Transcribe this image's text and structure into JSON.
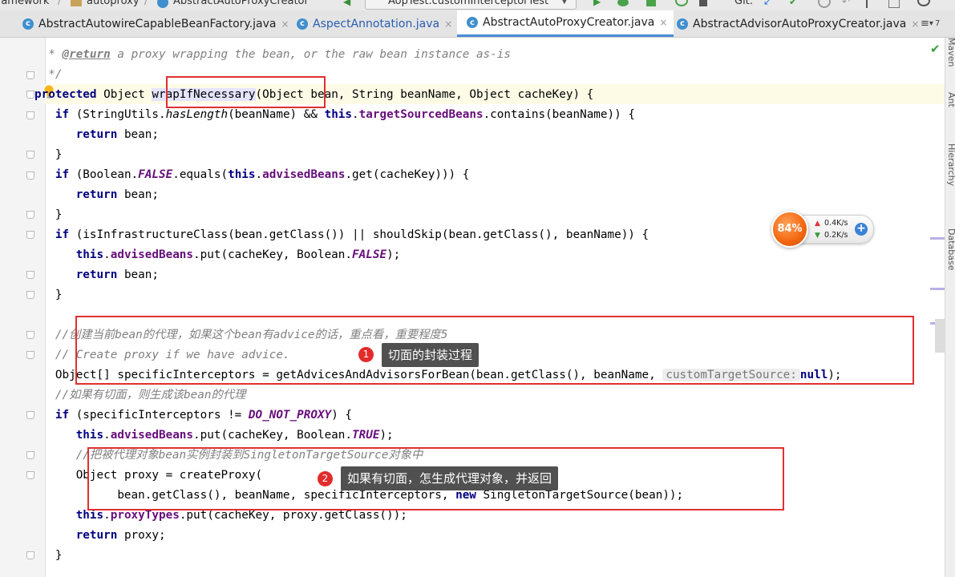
{
  "topbar": {
    "crumb1": "ramework",
    "crumb2": "autoproxy",
    "crumb3": "AbstractAutoProxyCreator",
    "run_config": "AopTest.customInterceptorTest",
    "vcs_label": "Git:"
  },
  "tabs": [
    {
      "label": "AbstractAutowireCapableBeanFactory.java",
      "icon": "class-icon",
      "close": "×"
    },
    {
      "label": "AspectAnnotation.java",
      "icon": "class-icon",
      "close": "×"
    },
    {
      "label": "AbstractAutoProxyCreator.java",
      "icon": "class-icon",
      "close": "×"
    },
    {
      "label": "AbstractAdvisorAutoProxyCreator.java",
      "icon": "class-icon",
      "close": "×"
    }
  ],
  "tab_overflow": "≡",
  "tab_overflow_count": "7",
  "right_tool_windows": [
    "Maven",
    "Ant",
    "Hierarchy",
    "Database"
  ],
  "code": {
    "l1_star": " * ",
    "l1_tag": "@return",
    "l1_text": " a proxy wrapping the bean, or the raw bean instance as-is",
    "l2": " */",
    "l3_kw": "protected",
    "l3_type": " Object ",
    "l3_method": "wrapIfNecessary",
    "l3_params": "(Object bean, String beanName, Object cacheKey) {",
    "l4_kw": "if",
    "l4_a": " (StringUtils.",
    "l4_b": "hasLength",
    "l4_c": "(beanName) && ",
    "l4_this": "this",
    "l4_d": ".",
    "l4_field": "targetSourcedBeans",
    "l4_e": ".contains(beanName)) {",
    "l5_kw": "return",
    "l5_rest": " bean;",
    "l6": "}",
    "l7_kw": "if",
    "l7_a": " (Boolean.",
    "l7_const": "FALSE",
    "l7_b": ".equals(",
    "l7_this": "this",
    "l7_c": ".",
    "l7_field": "advisedBeans",
    "l7_d": ".get(cacheKey))) {",
    "l8_kw": "return",
    "l8_rest": " bean;",
    "l9": "}",
    "l10_kw": "if",
    "l10_rest": " (isInfrastructureClass(bean.getClass()) || shouldSkip(bean.getClass(), beanName)) {",
    "l11_this": "this",
    "l11_a": ".",
    "l11_field": "advisedBeans",
    "l11_b": ".put(cacheKey, Boolean.",
    "l11_const": "FALSE",
    "l11_c": ");",
    "l12_kw": "return",
    "l12_rest": " bean;",
    "l13": "}",
    "l14_comment": "//创建当前bean的代理，如果这个bean有advice的话，重点看，重要程度5",
    "l15_comment": "// Create proxy if we have advice.",
    "l16_a": "Object[] specificInterceptors = getAdvicesAndAdvisorsForBean(bean.getClass(), beanName, ",
    "l16_hint": "customTargetSource:",
    "l16_null": "null",
    "l16_end": ");",
    "l17_comment": "//如果有切面，则生成该bean的代理",
    "l18_kw": "if",
    "l18_a": " (specificInterceptors != ",
    "l18_const": "DO_NOT_PROXY",
    "l18_b": ") {",
    "l19_this": "this",
    "l19_a": ".",
    "l19_field": "advisedBeans",
    "l19_b": ".put(cacheKey, Boolean.",
    "l19_const": "TRUE",
    "l19_c": ");",
    "l20_comment": "//把被代理对象bean实例封装到SingletonTargetSource对象中",
    "l21": "Object proxy = createProxy(",
    "l22_a": "bean.getClass(), beanName, specificInterceptors, ",
    "l22_kw": "new",
    "l22_b": " SingletonTargetSource(bean));",
    "l23_this": "this",
    "l23_a": ".",
    "l23_field": "proxyTypes",
    "l23_b": ".put(cacheKey, proxy.getClass());",
    "l24_kw": "return",
    "l24_rest": " proxy;",
    "l25": "}"
  },
  "annotations": {
    "badge1": "1",
    "tip1": "切面的封装过程",
    "badge2": "2",
    "tip2": "如果有切面，怎生成代理对象，并返回"
  },
  "net_widget": {
    "cpu": "84%",
    "up": "0.4K/s",
    "down": "0.2K/s",
    "plus": "+"
  },
  "colors": {
    "keyword": "#000080",
    "field": "#660e7a",
    "comment": "#808080",
    "annotation_box": "#e03030",
    "current_line": "#fdfbe6"
  }
}
